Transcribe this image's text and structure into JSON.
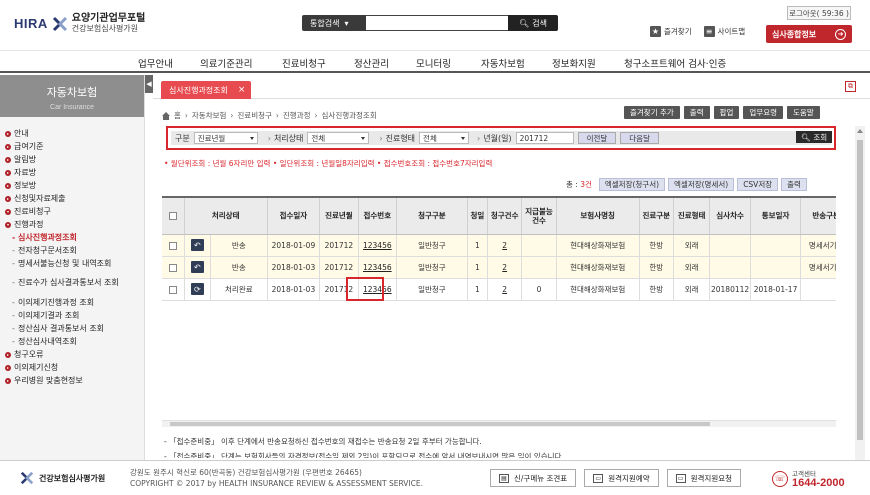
{
  "header": {
    "logo_text": "HIRA",
    "logo_title": "요양기관업무포털",
    "logo_subtitle": "건강보험심사평가원",
    "search_scope": "통합검색",
    "search_placeholder": "",
    "search_button": "검색",
    "logout_label": "로그아웃( 59:36 )",
    "bookmark_label": "즐겨찾기",
    "sitemap_label": "사이트맵",
    "portal_button": "심사종합정보"
  },
  "gnb": [
    "업무안내",
    "의료기준관리",
    "진료비청구",
    "정산관리",
    "모니터링",
    "자동차보험",
    "정보화지원",
    "청구소프트웨어 검사·인증"
  ],
  "sidebar": {
    "title": "자동차보험",
    "subtitle": "Car Insurance",
    "fold_label": "◀",
    "items": [
      {
        "label": "안내",
        "level": 1
      },
      {
        "label": "급여기준",
        "level": 1
      },
      {
        "label": "알림방",
        "level": 1
      },
      {
        "label": "자료방",
        "level": 1
      },
      {
        "label": "정보방",
        "level": 1
      },
      {
        "label": "신청및자료제출",
        "level": 1
      },
      {
        "label": "진료비청구",
        "level": 1,
        "open": true
      },
      {
        "label": "진행과정",
        "level": 1,
        "open": true
      },
      {
        "label": "심사진행과정조회",
        "level": 2,
        "active": true
      },
      {
        "label": "전자청구문서조회",
        "level": 2
      },
      {
        "label": "명세서불능신청 및 내역조회",
        "level": 2
      },
      {
        "label": "진료수가 심사결과통보서 조회",
        "level": 2,
        "tall": true
      },
      {
        "label": "이의제기진행과정 조회",
        "level": 2
      },
      {
        "label": "이의제기결과 조회",
        "level": 2
      },
      {
        "label": "정산심사 결과통보서 조회",
        "level": 2
      },
      {
        "label": "정산심사내역조회",
        "level": 2
      },
      {
        "label": "청구오류",
        "level": 1
      },
      {
        "label": "이의제기신청",
        "level": 1
      },
      {
        "label": "우리병원 맞춤현정보",
        "level": 1
      }
    ]
  },
  "tab": {
    "label": "심사진행과정조회",
    "close": "×",
    "tool_icon": "⧉"
  },
  "breadcrumb": [
    "홈",
    "자동차보험",
    "진료비청구",
    "진행과정",
    "심사진행과정조회"
  ],
  "top_buttons": [
    "즐겨찾기 추가",
    "출력",
    "팝업",
    "업무요령",
    "도움말"
  ],
  "filter": {
    "type_label": "구분",
    "type_value": "진료년월",
    "status_label": "처리상태",
    "status_value": "전체",
    "care_label": "진료형태",
    "care_value": "전체",
    "month_label": "년월(일)",
    "month_value": "201712",
    "prev_label": "이전달",
    "next_label": "다음달",
    "search_label": "조회"
  },
  "notice_red": "• 월단위조회 : 년월 6자리만 입력   • 일단위조회 : 년월일8자리입력   • 접수번호조회 : 접수번호7자리입력",
  "list": {
    "count_prefix": "총 : ",
    "count_value": "3건",
    "buttons": [
      "엑셀저장(청구서)",
      "엑셀저장(명세서)",
      "CSV저장",
      "출력"
    ]
  },
  "table": {
    "headers": [
      "",
      "처리상태",
      "",
      "접수일자",
      "진료년월",
      "접수번호",
      "청구구분",
      "청일",
      "청구건수",
      "지급불능건수",
      "보험사명칭",
      "진료구분",
      "진료형태",
      "심사차수",
      "통보일자",
      "반송구분"
    ],
    "rows": [
      {
        "icon": "↶",
        "status": "반송",
        "date": "2018-01-09",
        "ym": "201712",
        "no": "123456",
        "type": "일반청구",
        "day": "1",
        "cnt": "2",
        "fail": "",
        "ins": "현대해상화재보험",
        "kind": "한방",
        "form": "외래",
        "round": "",
        "notice": "",
        "ret": "명세서기재"
      },
      {
        "icon": "↶",
        "status": "반송",
        "date": "2018-01-03",
        "ym": "201712",
        "no": "123456",
        "type": "일반청구",
        "day": "1",
        "cnt": "2",
        "fail": "",
        "ins": "현대해상화재보험",
        "kind": "한방",
        "form": "외래",
        "round": "",
        "notice": "",
        "ret": "명세서기재"
      },
      {
        "icon": "⟳",
        "status": "처리완료",
        "date": "2018-01-03",
        "ym": "201712",
        "no": "123456",
        "type": "일반청구",
        "day": "1",
        "cnt": "2",
        "fail": "0",
        "ins": "현대해상화재보험",
        "kind": "한방",
        "form": "외래",
        "round": "20180112",
        "notice": "2018-01-17",
        "ret": ""
      }
    ]
  },
  "notes": [
    "- 「접수준비중」 이후 단계에서 반송요청하신 접수번호의 재접수는 반송요청 2일 후부터 가능합니다.",
    "- 「접수준비중」 단계는 보험회사들의 자격정보(접수일 제외 2일)이 포함되므로 접수에 앞서 내역보내시면 많은 일이 있습니다."
  ],
  "footer": {
    "org": "건강보험심사평가원",
    "address": "강원도 원주시 혁신로 60(반곡동) 건강보험심사평가원 (우편번호 26465)",
    "copyright": "COPYRIGHT © 2017 by HEALTH INSURANCE REVIEW & ASSESSMENT SERVICE.",
    "buttons": [
      "신/구메뉴 조견표",
      "원격지원예약",
      "원격지원요청"
    ],
    "call_label": "고객센터",
    "call_number": "1644-2000"
  }
}
